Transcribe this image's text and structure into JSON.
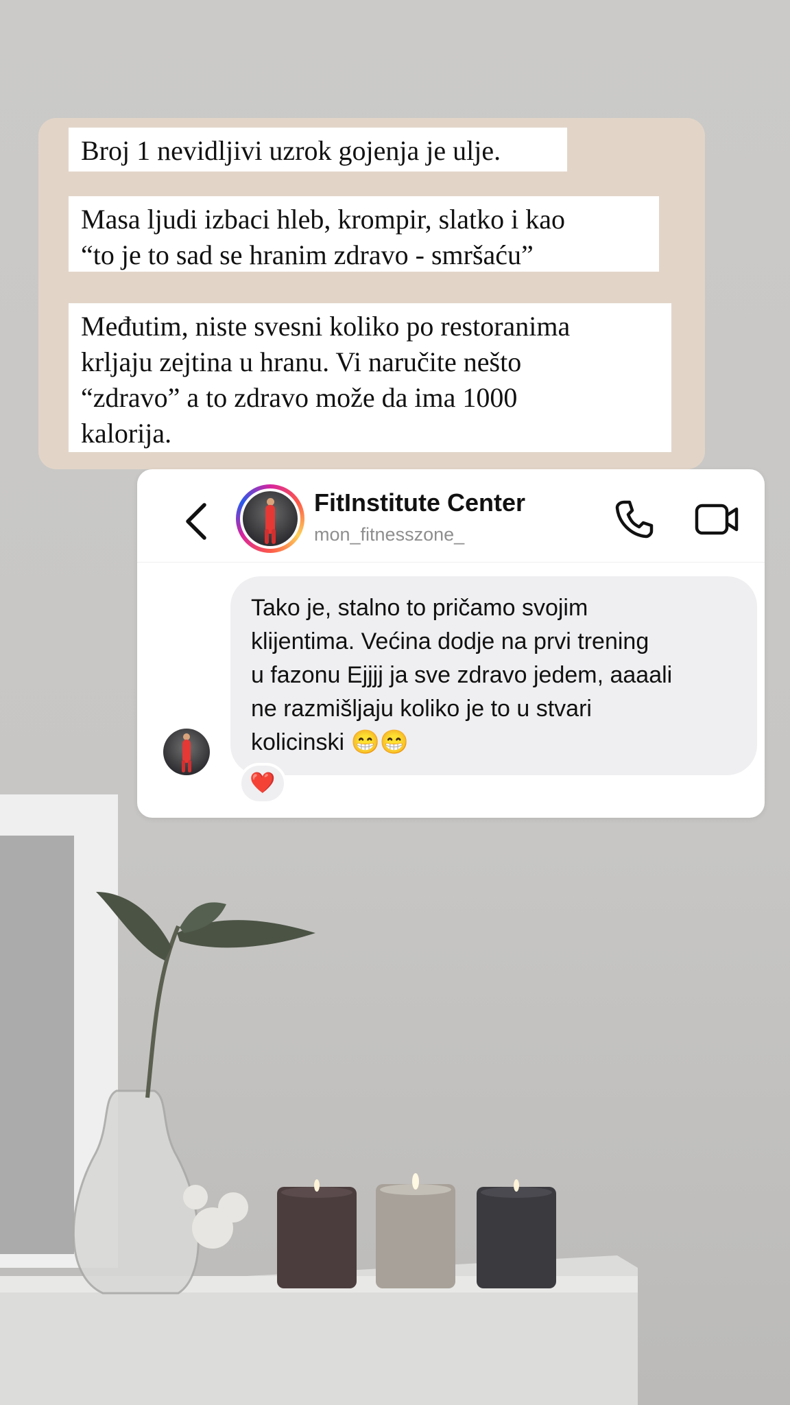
{
  "story": {
    "lines": [
      "Broj 1 nevidljivi uzrok gojenja je ulje.",
      "Masa ljudi izbaci hleb, krompir, slatko i kao\n“to je to sad se hranim zdravo - smršaću”",
      "Međutim, niste svesni koliko po restoranima\nkrljaju zejtina u hranu. Vi naručite nešto\n“zdravo” a to zdravo može da ima 1000\nkalorija."
    ]
  },
  "dm": {
    "contact_name": "FitInstitute Center",
    "contact_handle": "mon_fitnesszone_",
    "back_icon": "chevron-left-icon",
    "call_icon": "phone-icon",
    "video_icon": "video-camera-icon",
    "message": {
      "text": "Tako je, stalno to pričamo svojim\nklijentima. Većina dodje na prvi trening\nu fazonu Ejjjj ja sve zdravo jedem, aaaali\nne razmišljaju koliko je to u stvari\nkolicinski 😁😁",
      "reaction": "❤️"
    }
  },
  "colors": {
    "story_card": "#e2d5c8",
    "bubble": "#efeff1",
    "wall": "#c9c8c6"
  }
}
